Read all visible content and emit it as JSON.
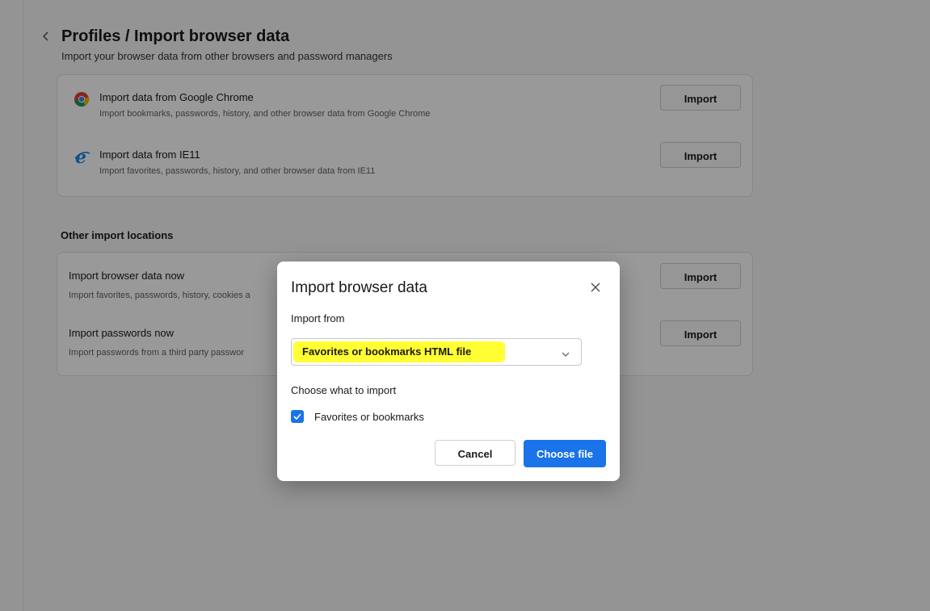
{
  "header": {
    "back_icon": "chevron-left-icon",
    "title": "Profiles / Import browser data",
    "subtitle": "Import your browser data from other browsers and password managers"
  },
  "browser_sources": [
    {
      "icon": "chrome-icon",
      "title": "Import data from Google Chrome",
      "description": "Import bookmarks, passwords, history, and other browser data from Google Chrome",
      "button_label": "Import"
    },
    {
      "icon": "internet-explorer-icon",
      "title": "Import data from IE11",
      "description": "Import favorites, passwords, history, and other browser data from IE11",
      "button_label": "Import"
    }
  ],
  "other_locations": {
    "heading": "Other import locations",
    "items": [
      {
        "title": "Import browser data now",
        "description": "Import favorites, passwords, history, cookies a",
        "button_label": "Import"
      },
      {
        "title": "Import passwords now",
        "description": "Import passwords from a third party passwor",
        "button_label": "Import"
      }
    ]
  },
  "dialog": {
    "title": "Import browser data",
    "close_icon": "close-icon",
    "import_from_label": "Import from",
    "import_from_value": "Favorites or bookmarks HTML file",
    "choose_label": "Choose what to import",
    "options": [
      {
        "label": "Favorites or bookmarks",
        "checked": true
      }
    ],
    "cancel_label": "Cancel",
    "choose_file_label": "Choose file"
  },
  "colors": {
    "accent": "#1a73e8",
    "highlight": "#ffff33"
  }
}
